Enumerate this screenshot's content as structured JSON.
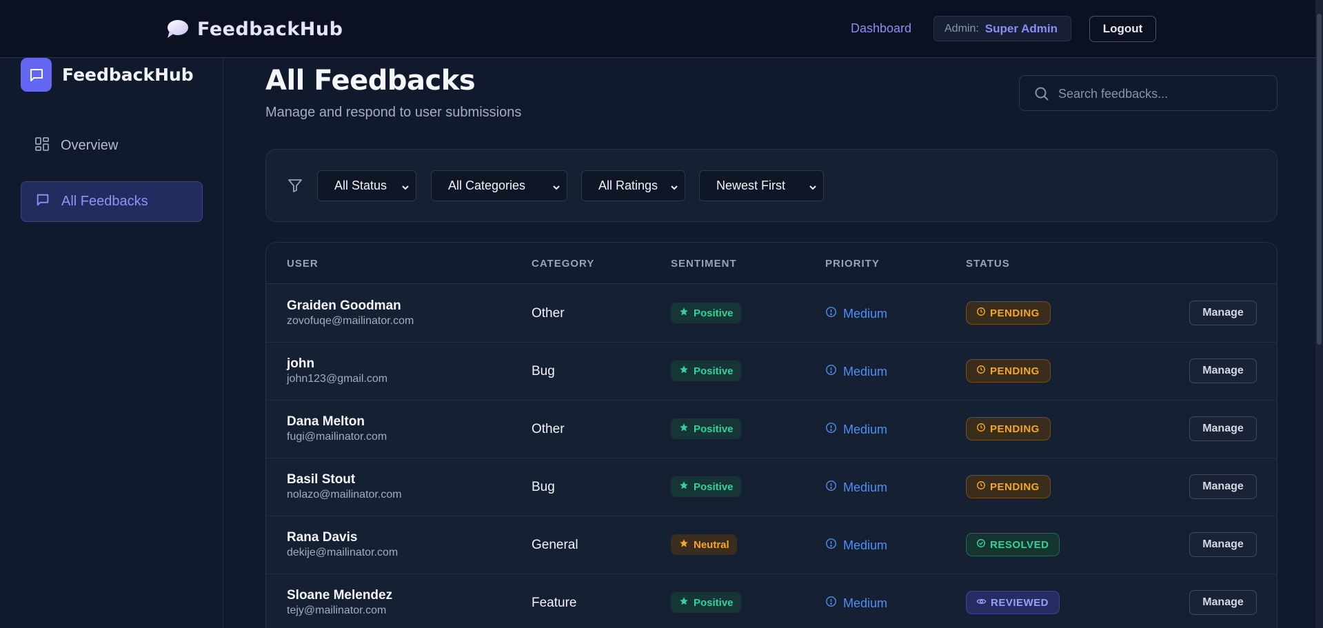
{
  "header": {
    "brand": "FeedbackHub",
    "nav_dashboard": "Dashboard",
    "admin_label": "Admin:",
    "admin_name": "Super Admin",
    "logout_label": "Logout"
  },
  "sidebar": {
    "brand": "FeedbackHub",
    "items": [
      {
        "label": "Overview",
        "icon": "grid-icon",
        "active": false
      },
      {
        "label": "All Feedbacks",
        "icon": "message-square-icon",
        "active": true
      }
    ]
  },
  "main": {
    "title": "All Feedbacks",
    "subtitle": "Manage and respond to user submissions",
    "search_placeholder": "Search feedbacks..."
  },
  "filters": {
    "status": "All Status",
    "categories": "All Categories",
    "ratings": "All Ratings",
    "sort": "Newest First"
  },
  "table": {
    "headers": [
      "USER",
      "CATEGORY",
      "SENTIMENT",
      "PRIORITY",
      "STATUS"
    ],
    "manage_label": "Manage",
    "rows": [
      {
        "name": "Graiden Goodman",
        "email": "zovofuqe@mailinator.com",
        "category": "Other",
        "sentiment": "Positive",
        "priority": "Medium",
        "status": "PENDING"
      },
      {
        "name": "john",
        "email": "john123@gmail.com",
        "category": "Bug",
        "sentiment": "Positive",
        "priority": "Medium",
        "status": "PENDING"
      },
      {
        "name": "Dana Melton",
        "email": "fugi@mailinator.com",
        "category": "Other",
        "sentiment": "Positive",
        "priority": "Medium",
        "status": "PENDING"
      },
      {
        "name": "Basil Stout",
        "email": "nolazo@mailinator.com",
        "category": "Bug",
        "sentiment": "Positive",
        "priority": "Medium",
        "status": "PENDING"
      },
      {
        "name": "Rana Davis",
        "email": "dekije@mailinator.com",
        "category": "General",
        "sentiment": "Neutral",
        "priority": "Medium",
        "status": "RESOLVED"
      },
      {
        "name": "Sloane Melendez",
        "email": "tejy@mailinator.com",
        "category": "Feature",
        "sentiment": "Positive",
        "priority": "Medium",
        "status": "REVIEWED"
      }
    ]
  },
  "colors": {
    "accent": "#6366f1",
    "positive": "#34d399",
    "neutral": "#f5a623",
    "priority": "#4d8ff5",
    "reviewed": "#9b9ff8"
  }
}
